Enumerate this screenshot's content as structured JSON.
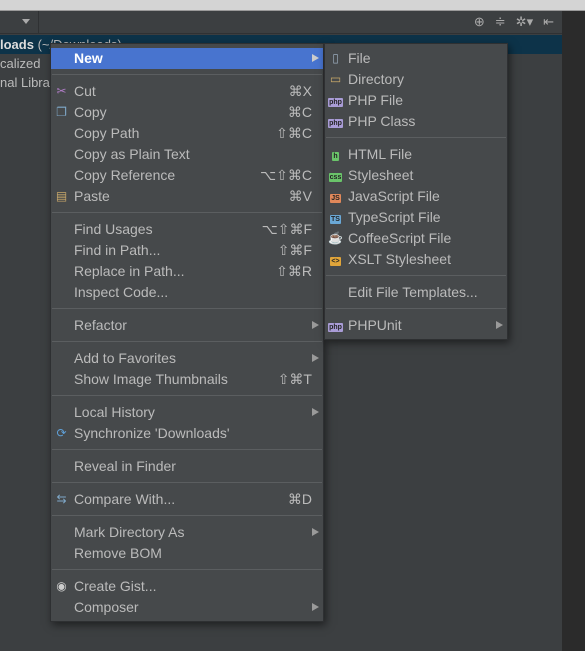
{
  "tree": {
    "selected_label": "loads",
    "selected_path": " (~/Downloads)",
    "rows": [
      "calized",
      "nal Librar"
    ]
  },
  "colors": {
    "highlight": "#4874cf",
    "menu_bg": "#46494b",
    "selection": "#0d3349"
  },
  "main_menu": [
    {
      "label": "New",
      "submenu": true,
      "highlighted": true
    },
    {
      "sep": true
    },
    {
      "label": "Cut",
      "shortcut": "⌘X",
      "icon": "scissors-icon"
    },
    {
      "label": "Copy",
      "shortcut": "⌘C",
      "icon": "copy-icon"
    },
    {
      "label": "Copy Path",
      "shortcut": "⇧⌘C"
    },
    {
      "label": "Copy as Plain Text"
    },
    {
      "label": "Copy Reference",
      "shortcut": "⌥⇧⌘C"
    },
    {
      "label": "Paste",
      "shortcut": "⌘V",
      "icon": "paste-icon"
    },
    {
      "sep": true
    },
    {
      "label": "Find Usages",
      "shortcut": "⌥⇧⌘F"
    },
    {
      "label": "Find in Path...",
      "shortcut": "⇧⌘F"
    },
    {
      "label": "Replace in Path...",
      "shortcut": "⇧⌘R"
    },
    {
      "label": "Inspect Code..."
    },
    {
      "sep": true
    },
    {
      "label": "Refactor",
      "submenu": true
    },
    {
      "sep": true
    },
    {
      "label": "Add to Favorites",
      "submenu": true
    },
    {
      "label": "Show Image Thumbnails",
      "shortcut": "⇧⌘T"
    },
    {
      "sep": true
    },
    {
      "label": "Local History",
      "submenu": true
    },
    {
      "label": "Synchronize 'Downloads'",
      "icon": "sync-icon"
    },
    {
      "sep": true
    },
    {
      "label": "Reveal in Finder"
    },
    {
      "sep": true
    },
    {
      "label": "Compare With...",
      "shortcut": "⌘D",
      "icon": "compare-icon"
    },
    {
      "sep": true
    },
    {
      "label": "Mark Directory As",
      "submenu": true
    },
    {
      "label": "Remove BOM"
    },
    {
      "sep": true
    },
    {
      "label": "Create Gist...",
      "icon": "github-icon"
    },
    {
      "label": "Composer",
      "submenu": true
    }
  ],
  "sub_menu": [
    {
      "label": "File",
      "icon": "file-icon"
    },
    {
      "label": "Directory",
      "icon": "folder-icon"
    },
    {
      "label": "PHP File",
      "icon": "php-file-icon"
    },
    {
      "label": "PHP Class",
      "icon": "php-class-icon"
    },
    {
      "sep": true
    },
    {
      "label": "HTML File",
      "icon": "html-file-icon"
    },
    {
      "label": "Stylesheet",
      "icon": "css-file-icon"
    },
    {
      "label": "JavaScript File",
      "icon": "js-file-icon"
    },
    {
      "label": "TypeScript File",
      "icon": "ts-file-icon"
    },
    {
      "label": "CoffeeScript File",
      "icon": "coffee-file-icon"
    },
    {
      "label": "XSLT Stylesheet",
      "icon": "xslt-file-icon"
    },
    {
      "sep": true
    },
    {
      "label": "Edit File Templates..."
    },
    {
      "sep": true
    },
    {
      "label": "PHPUnit",
      "submenu": true,
      "icon": "phpunit-icon"
    }
  ]
}
